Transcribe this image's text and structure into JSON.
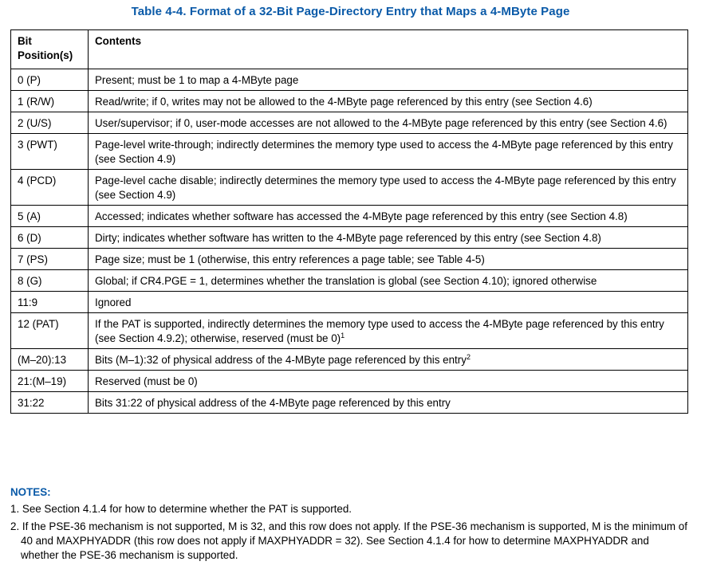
{
  "caption": "Table 4-4.  Format of a 32-Bit Page-Directory Entry that Maps a 4-MByte Page",
  "header": {
    "col1": "Bit Position(s)",
    "col2": "Contents"
  },
  "rows": [
    {
      "pos": "0 (P)",
      "text": "Present; must be 1 to map a 4-MByte page",
      "sup": ""
    },
    {
      "pos": "1 (R/W)",
      "text": "Read/write; if 0, writes may not be allowed to the 4-MByte page referenced by this entry (see Section 4.6)",
      "sup": ""
    },
    {
      "pos": "2 (U/S)",
      "text": "User/supervisor; if 0, user-mode accesses are not allowed to the 4-MByte page referenced by this entry (see Section 4.6)",
      "sup": ""
    },
    {
      "pos": "3 (PWT)",
      "text": "Page-level write-through; indirectly determines the memory type used to access the 4-MByte page referenced by this entry (see Section 4.9)",
      "sup": ""
    },
    {
      "pos": "4 (PCD)",
      "text": "Page-level cache disable; indirectly determines the memory type used to access the 4-MByte page referenced by this entry (see Section 4.9)",
      "sup": ""
    },
    {
      "pos": "5 (A)",
      "text": "Accessed; indicates whether software has accessed the 4-MByte page referenced by this entry (see Section 4.8)",
      "sup": ""
    },
    {
      "pos": "6 (D)",
      "text": "Dirty; indicates whether software has written to the 4-MByte page referenced by this entry (see Section 4.8)",
      "sup": ""
    },
    {
      "pos": "7 (PS)",
      "text": "Page size; must be 1 (otherwise, this entry references a page table; see Table 4-5)",
      "sup": ""
    },
    {
      "pos": "8 (G)",
      "text": "Global; if CR4.PGE = 1, determines whether the translation is global (see Section 4.10); ignored otherwise",
      "sup": ""
    },
    {
      "pos": "11:9",
      "text": "Ignored",
      "sup": ""
    },
    {
      "pos": "12 (PAT)",
      "text": "If the PAT is supported, indirectly determines the memory type used to access the 4-MByte page referenced by this entry (see Section 4.9.2); otherwise, reserved (must be 0)",
      "sup": "1"
    },
    {
      "pos": "(M–20):13",
      "text": "Bits (M–1):32 of physical address of the 4-MByte page referenced by this entry",
      "sup": "2"
    },
    {
      "pos": "21:(M–19)",
      "text": "Reserved (must be 0)",
      "sup": ""
    },
    {
      "pos": "31:22",
      "text": "Bits 31:22 of physical address of the 4-MByte page referenced by this entry",
      "sup": ""
    }
  ],
  "notes": {
    "title": "NOTES:",
    "items": [
      "1. See Section 4.1.4 for how to determine whether the PAT is supported.",
      "2. If the PSE-36 mechanism is not supported, M is 32, and this row does not apply. If the PSE-36 mechanism is supported, M is the minimum of 40 and MAXPHYADDR (this row does not apply if MAXPHYADDR = 32). See Section 4.1.4 for how to determine MAXPHYADDR and whether the PSE-36 mechanism is supported."
    ]
  }
}
